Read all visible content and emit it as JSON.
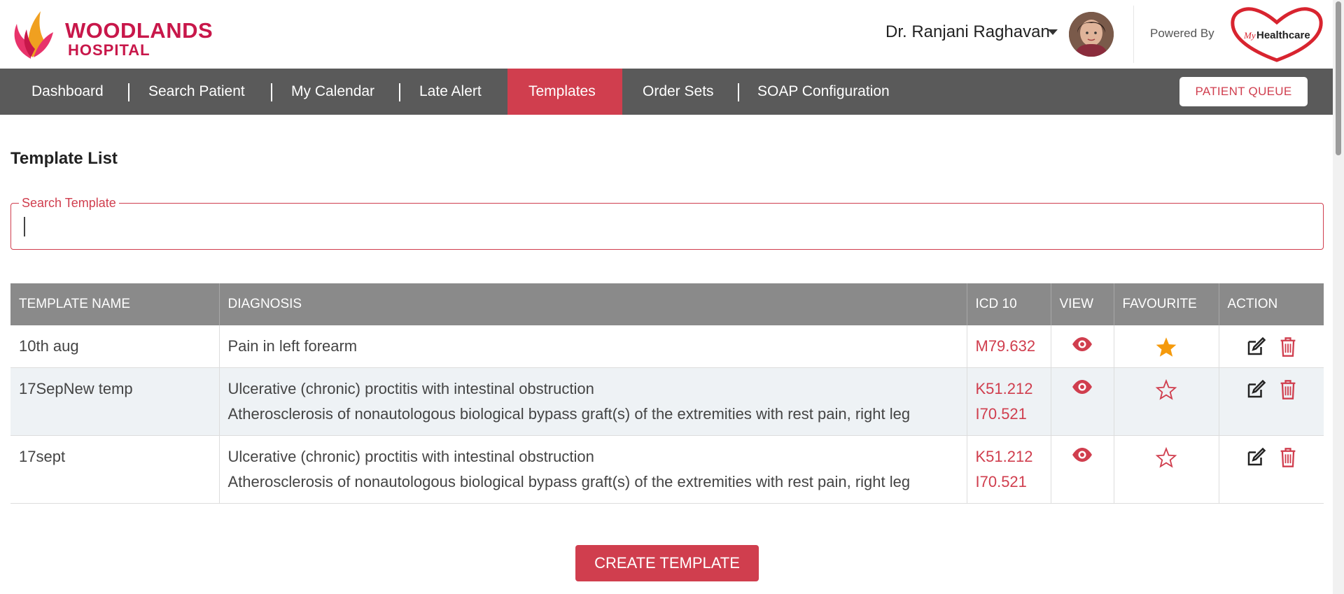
{
  "brand": {
    "logo_line1": "WOODLANDS",
    "logo_line2": "HOSPITAL",
    "powered_by": "Powered By",
    "partner_logo": "MyHealthcare",
    "partner_logo_prefix": "My",
    "partner_logo_suffix": "Healthcare",
    "accent_color": "#d03e4e"
  },
  "user": {
    "name": "Dr. Ranjani Raghavan"
  },
  "nav": {
    "items": [
      {
        "label": "Dashboard",
        "active": false
      },
      {
        "label": "Search Patient",
        "active": false
      },
      {
        "label": "My Calendar",
        "active": false
      },
      {
        "label": "Late Alert",
        "active": false
      },
      {
        "label": "Templates",
        "active": true
      },
      {
        "label": "Order Sets",
        "active": false
      },
      {
        "label": "SOAP Configuration",
        "active": false
      }
    ],
    "queue_button": "PATIENT QUEUE"
  },
  "main": {
    "title": "Template List",
    "search": {
      "label": "Search Template",
      "value": "",
      "placeholder": ""
    },
    "table": {
      "columns": [
        "TEMPLATE NAME",
        "DIAGNOSIS",
        "ICD 10",
        "VIEW",
        "FAVOURITE",
        "ACTION"
      ],
      "rows": [
        {
          "name": "10th aug",
          "diagnoses": [
            "Pain in left forearm"
          ],
          "icd": [
            "M79.632"
          ],
          "favourite": true
        },
        {
          "name": "17SepNew temp",
          "diagnoses": [
            "Ulcerative (chronic) proctitis with intestinal obstruction",
            "Atherosclerosis of nonautologous biological bypass graft(s) of the extremities with rest pain, right leg"
          ],
          "icd": [
            "K51.212",
            "I70.521"
          ],
          "favourite": false
        },
        {
          "name": "17sept",
          "diagnoses": [
            "Ulcerative (chronic) proctitis with intestinal obstruction",
            "Atherosclerosis of nonautologous biological bypass graft(s) of the extremities with rest pain, right leg"
          ],
          "icd": [
            "K51.212",
            "I70.521"
          ],
          "favourite": false
        }
      ]
    },
    "create_button": "CREATE TEMPLATE"
  },
  "icons": {
    "view": "eye-icon",
    "favourite_on": "star-filled-icon",
    "favourite_off": "star-outline-icon",
    "edit": "edit-icon",
    "delete": "trash-icon",
    "favourite_color": "#f59a0c"
  }
}
